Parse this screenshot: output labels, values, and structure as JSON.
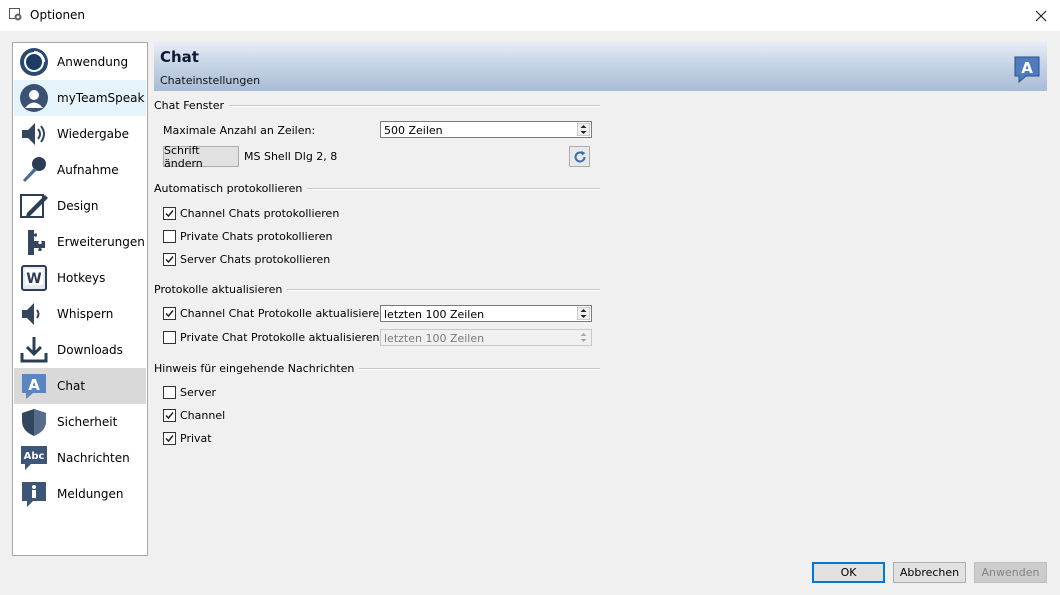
{
  "window": {
    "title": "Optionen"
  },
  "sidebar": {
    "items": [
      {
        "label": "Anwendung",
        "icon": "ring-icon"
      },
      {
        "label": "myTeamSpeak",
        "icon": "user-avatar-icon"
      },
      {
        "label": "Wiedergabe",
        "icon": "speaker-icon"
      },
      {
        "label": "Aufnahme",
        "icon": "microphone-icon"
      },
      {
        "label": "Design",
        "icon": "pencil-icon"
      },
      {
        "label": "Erweiterungen",
        "icon": "puzzle-icon"
      },
      {
        "label": "Hotkeys",
        "icon": "key-w-icon"
      },
      {
        "label": "Whispern",
        "icon": "whisper-speaker-icon"
      },
      {
        "label": "Downloads",
        "icon": "download-icon"
      },
      {
        "label": "Chat",
        "icon": "chat-a-icon"
      },
      {
        "label": "Sicherheit",
        "icon": "shield-icon"
      },
      {
        "label": "Nachrichten",
        "icon": "abc-bubble-icon"
      },
      {
        "label": "Meldungen",
        "icon": "info-bubble-icon"
      }
    ],
    "selected": "Chat",
    "hovered": "myTeamSpeak"
  },
  "header": {
    "title": "Chat",
    "subtitle": "Chateinstellungen"
  },
  "chat_window": {
    "group_title": "Chat Fenster",
    "max_lines_label": "Maximale Anzahl an Zeilen:",
    "max_lines_value": "500 Zeilen",
    "font_button": "Schrift ändern",
    "font_value": "MS Shell Dlg 2, 8"
  },
  "auto_log": {
    "group_title": "Automatisch protokollieren",
    "options": [
      {
        "label": "Channel Chats protokollieren",
        "checked": true
      },
      {
        "label": "Private Chats protokollieren",
        "checked": false
      },
      {
        "label": "Server Chats protokollieren",
        "checked": true
      }
    ]
  },
  "log_update": {
    "group_title": "Protokolle aktualisieren",
    "channel_label": "Channel Chat Protokolle aktualisieren",
    "channel_checked": true,
    "channel_value": "letzten 100 Zeilen",
    "private_label": "Private Chat Protokolle aktualisieren",
    "private_checked": false,
    "private_value": "letzten 100 Zeilen"
  },
  "notify": {
    "group_title": "Hinweis für eingehende Nachrichten",
    "options": [
      {
        "label": "Server",
        "checked": false
      },
      {
        "label": "Channel",
        "checked": true
      },
      {
        "label": "Privat",
        "checked": true
      }
    ]
  },
  "footer": {
    "ok": "OK",
    "cancel": "Abbrechen",
    "apply": "Anwenden"
  },
  "colors": {
    "selected_bg": "#d9d9d9",
    "hover_bg": "#e5f3fb",
    "header_gradient_end": "#a9bcd6",
    "default_button_border": "#0078d7"
  }
}
